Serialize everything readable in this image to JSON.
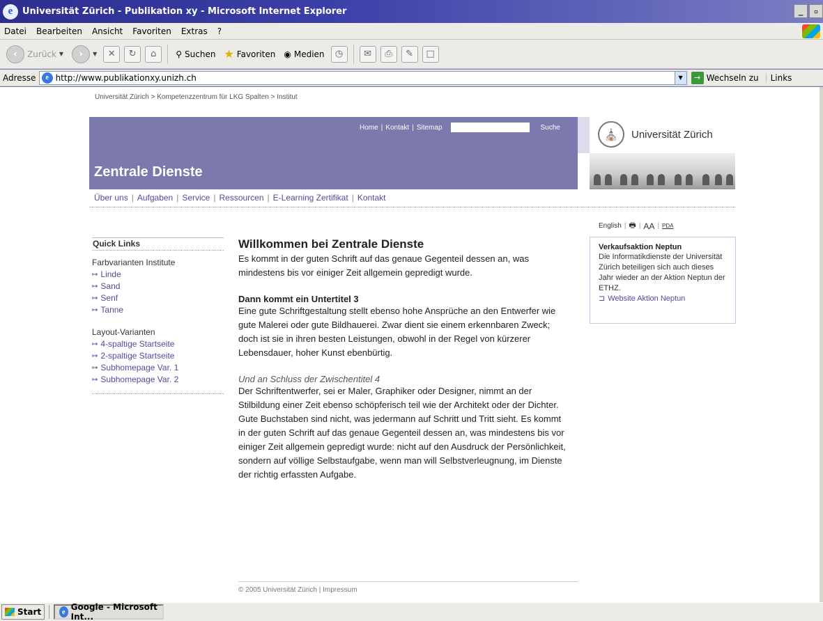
{
  "window": {
    "title": "Universität Zürich - Publikation xy - Microsoft Internet Explorer",
    "buttons": [
      "_",
      "▫"
    ]
  },
  "menubar": [
    "Datei",
    "Bearbeiten",
    "Ansicht",
    "Favoriten",
    "Extras",
    "?"
  ],
  "toolbar": {
    "back": "Zurück",
    "search": "Suchen",
    "favorites": "Favoriten",
    "media": "Medien"
  },
  "addressbar": {
    "label": "Adresse",
    "url": "http://www.publikationxy.unizh.ch",
    "go": "Wechseln zu",
    "links": "Links"
  },
  "page": {
    "breadcrumb": "Universität Zürich > Kompetenzzentrum für LKG Spalten > Institut",
    "toplinks": [
      "Home",
      "|",
      "Kontakt",
      "|",
      "Sitemap"
    ],
    "search_button": "Suche",
    "banner_title": "Zentrale Dienste",
    "logo_text": "Universität Zürich",
    "nav": [
      "Über uns",
      "Aufgaben",
      "Service",
      "Ressourcen",
      "E-Learning Zertifikat",
      "Kontakt"
    ],
    "tools": {
      "language": "English",
      "font": "AA",
      "pda": "PDA"
    },
    "quicklinks": {
      "title": "Quick Links",
      "groups": [
        {
          "name": "Farbvarianten Institute",
          "links": [
            "Linde",
            "Sand",
            "Senf",
            "Tanne"
          ]
        },
        {
          "name": "Layout-Varianten",
          "links": [
            "4-spaltige Startseite",
            "2-spaltige Startseite",
            "Subhomepage Var. 1",
            "Subhomepage Var. 2"
          ]
        }
      ]
    },
    "main": {
      "heading": "Willkommen bei Zentrale Dienste",
      "intro": "Es kommt in der guten Schrift auf das genaue Gegenteil dessen an, was mindestens bis vor einiger Zeit allgemein gepredigt wurde.",
      "subheading": "Dann kommt ein Untertitel 3",
      "para2": "Eine gute Schriftgestaltung stellt ebenso hohe Ansprüche an den Entwerfer wie gute Malerei oder gute Bildhauerei. Zwar dient sie einem erkennbaren Zweck; doch ist sie in ihren besten Leistungen, obwohl in der Regel von kürzerer Lebensdauer, hoher Kunst ebenbürtig.",
      "interheading": "Und an Schluss der Zwischentitel 4",
      "para3": "Der Schriftentwerfer, sei er Maler, Graphiker oder Designer, nimmt an der Stilbildung einer Zeit ebenso schöpferisch teil wie der Architekt oder der Dichter. Gute Buchstaben sind nicht, was jedermann auf Schritt und Tritt sieht. Es kommt in der guten Schrift auf das genaue Gegenteil dessen an, was mindestens bis vor einiger Zeit allgemein gepredigt wurde: nicht auf den Ausdruck der Persönlichkeit, sondern auf völlige Selbstaufgabe, wenn man will Selbstverleugnung, im Dienste der richtig erfassten Aufgabe."
    },
    "sidebox": {
      "title": "Verkaufsaktion Neptun",
      "text": "Die Informatikdienste der Universität Zürich beteiligen sich auch dieses Jahr wieder an der Aktion Neptun der ETHZ.",
      "link": "Website Aktion Neptun"
    },
    "footer": "© 2005 Universität Zürich | Impressum"
  },
  "taskbar": {
    "start": "Start",
    "item": "Google - Microsoft Int..."
  }
}
